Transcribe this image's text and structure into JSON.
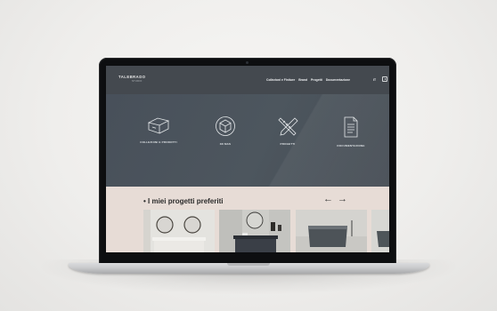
{
  "site": {
    "logo": "TALEBRADO",
    "logo_sub": "STUDIO",
    "nav": [
      "Collezioni e Finiture",
      "Brand",
      "Progetti",
      "Documentazione"
    ],
    "language": "IT"
  },
  "features": [
    {
      "label": "COLLEZIONI E PRODOTTI",
      "icon": "cabinet-icon"
    },
    {
      "label": "3D MAS",
      "icon": "cube-icon"
    },
    {
      "label": "PROGETTI",
      "icon": "drafting-tools-icon"
    },
    {
      "label": "DOCUMENTAZIONE",
      "icon": "document-icon"
    }
  ],
  "favorites": {
    "title": "• I miei progetti preferiti",
    "prev_arrow": "←",
    "next_arrow": "→"
  },
  "colors": {
    "screen_bg": "#4a5259",
    "nav_bg": "#44494f",
    "favorites_bg": "#e7dcd6"
  }
}
